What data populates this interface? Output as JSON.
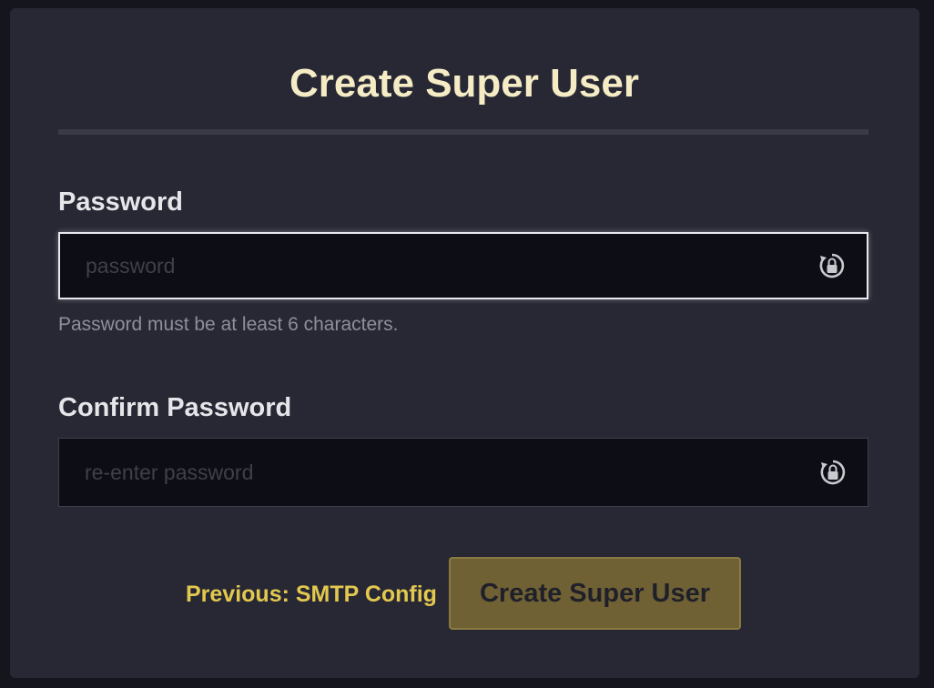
{
  "form": {
    "title": "Create Super User",
    "password": {
      "label": "Password",
      "placeholder": "password",
      "value": "",
      "hint": "Password must be at least 6 characters.",
      "icon": "password-visibility-icon"
    },
    "confirm_password": {
      "label": "Confirm Password",
      "placeholder": "re-enter password",
      "value": "",
      "icon": "password-visibility-icon"
    },
    "previous_link": "Previous: SMTP Config",
    "submit_label": "Create Super User"
  },
  "colors": {
    "background": "#15151d",
    "card": "#272834",
    "title": "#f5ecc6",
    "accent": "#e3c84e",
    "button": "#6f6134",
    "input": "#0d0d15"
  }
}
